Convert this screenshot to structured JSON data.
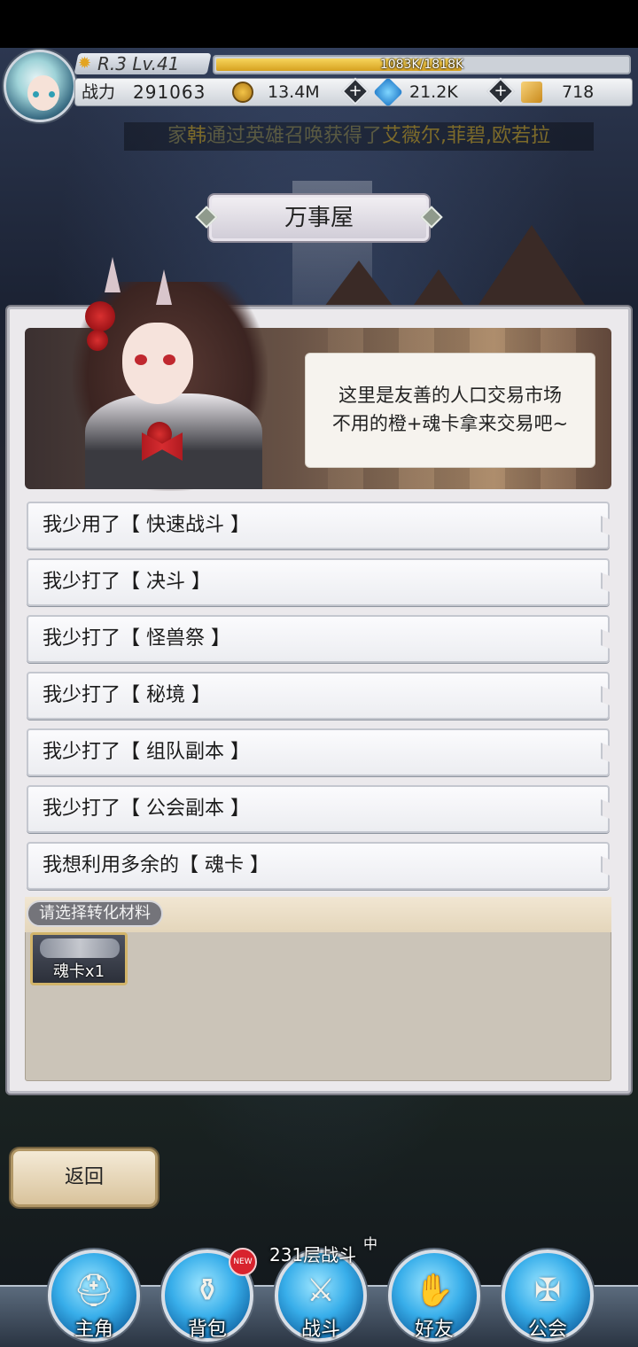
{
  "player": {
    "rank_level": "R.3 Lv.41",
    "exp_text": "1083K/1818K",
    "exp_progress": 0.596,
    "power_label": "战力",
    "power_value": "291063"
  },
  "resources": {
    "gold": "13.4M",
    "diamond": "21.2K",
    "card": "718"
  },
  "ticker": {
    "prefix": "家",
    "player_name": "韩",
    "middle": "通过英雄召唤获得了",
    "heroes": "艾薇尔,菲碧,欧若拉"
  },
  "shop": {
    "title": "万事屋",
    "speech_line1": "这里是友善的人口交易市场",
    "speech_line2": "不用的橙+魂卡拿来交易吧~"
  },
  "options": [
    {
      "label": "我少用了【 快速战斗 】"
    },
    {
      "label": "我少打了【 决斗 】"
    },
    {
      "label": "我少打了【 怪兽祭 】"
    },
    {
      "label": "我少打了【 秘境 】"
    },
    {
      "label": "我少打了【 组队副本 】"
    },
    {
      "label": "我少打了【 公会副本 】"
    },
    {
      "label": "我想利用多余的【 魂卡 】"
    }
  ],
  "material": {
    "header": "请选择转化材料",
    "item_label": "魂卡x1"
  },
  "back_label": "返回",
  "battle_status": {
    "text": "231层战斗",
    "suffix": "中"
  },
  "nav": {
    "hero": "主角",
    "bag": "背包",
    "battle": "战斗",
    "friends": "好友",
    "guild": "公会",
    "new_badge": "NEW"
  },
  "colors": {
    "nav_blue": "#38aeea",
    "exp_gold": "#d6a120",
    "badge_red": "#d8232e"
  }
}
